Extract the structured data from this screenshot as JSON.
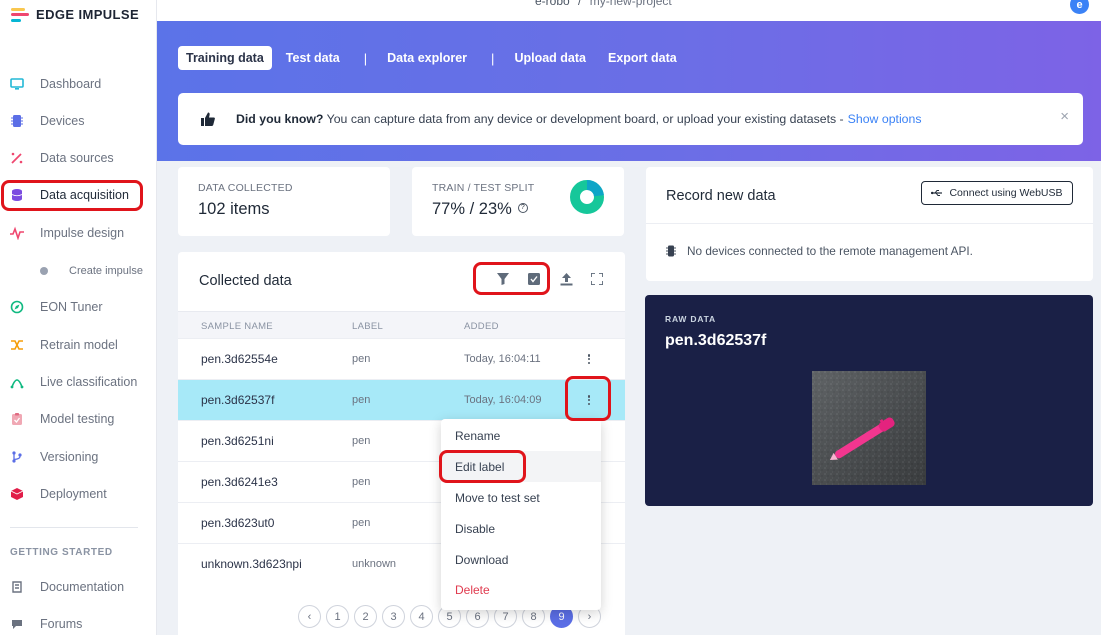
{
  "brand": {
    "name": "EDGE IMPULSE",
    "colors": [
      "#f9c74f",
      "#ef476f",
      "#06b6d4"
    ]
  },
  "topbar": {
    "org": "e-robo",
    "separator": "/",
    "project": "my-new-project",
    "avatar": "e"
  },
  "sidebar": {
    "items": [
      {
        "label": "Dashboard",
        "icon": "monitor-icon"
      },
      {
        "label": "Devices",
        "icon": "chip-icon"
      },
      {
        "label": "Data sources",
        "icon": "wand-icon"
      },
      {
        "label": "Data acquisition",
        "icon": "database-icon",
        "active": true
      },
      {
        "label": "Impulse design",
        "icon": "pulse-icon"
      },
      {
        "label": "EON Tuner",
        "icon": "compass-icon"
      },
      {
        "label": "Retrain model",
        "icon": "shuffle-icon"
      },
      {
        "label": "Live classification",
        "icon": "broadcast-icon"
      },
      {
        "label": "Model testing",
        "icon": "clipboard-icon"
      },
      {
        "label": "Versioning",
        "icon": "branch-icon"
      },
      {
        "label": "Deployment",
        "icon": "cube-icon"
      }
    ],
    "sub_item": {
      "label": "Create impulse"
    },
    "section_title": "GETTING STARTED",
    "getting_started": [
      {
        "label": "Documentation",
        "icon": "book-icon"
      },
      {
        "label": "Forums",
        "icon": "chat-icon"
      }
    ]
  },
  "tabs": [
    {
      "label": "Training data",
      "active": true
    },
    {
      "label": "Test data"
    },
    {
      "label": "Data explorer"
    },
    {
      "label": "Upload data"
    },
    {
      "label": "Export data"
    }
  ],
  "tab_separator": "|",
  "tip": {
    "bold": "Did you know?",
    "text": " You can capture data from any device or development board, or upload your existing datasets - ",
    "link": "Show options",
    "close": "×"
  },
  "stats": {
    "collected_label": "DATA COLLECTED",
    "collected_value": "102 items",
    "split_label": "TRAIN / TEST SPLIT",
    "split_value": "77% / 23%",
    "split_help": "?",
    "train_fraction": 0.77
  },
  "collected": {
    "title": "Collected data",
    "columns": [
      "SAMPLE NAME",
      "LABEL",
      "ADDED"
    ],
    "rows": [
      {
        "name": "pen.3d62554e",
        "label": "pen",
        "added": "Today, 16:04:11"
      },
      {
        "name": "pen.3d62537f",
        "label": "pen",
        "added": "Today, 16:04:09",
        "selected": true
      },
      {
        "name": "pen.3d6251ni",
        "label": "pen",
        "added": ""
      },
      {
        "name": "pen.3d6241e3",
        "label": "pen",
        "added": ""
      },
      {
        "name": "pen.3d623ut0",
        "label": "pen",
        "added": ""
      },
      {
        "name": "unknown.3d623npi",
        "label": "unknown",
        "added": ""
      }
    ]
  },
  "context_menu": {
    "items": [
      "Rename",
      "Edit label",
      "Move to test set",
      "Disable",
      "Download",
      "Delete"
    ]
  },
  "pagination": {
    "prev": "‹",
    "next": "›",
    "pages": [
      "1",
      "2",
      "3",
      "4",
      "5",
      "6",
      "7",
      "8",
      "9"
    ],
    "current": "9"
  },
  "record": {
    "title": "Record new data",
    "connect_button": "Connect using WebUSB",
    "message": "No devices connected to the remote management API."
  },
  "raw": {
    "label": "RAW DATA",
    "name": "pen.3d62537f"
  }
}
